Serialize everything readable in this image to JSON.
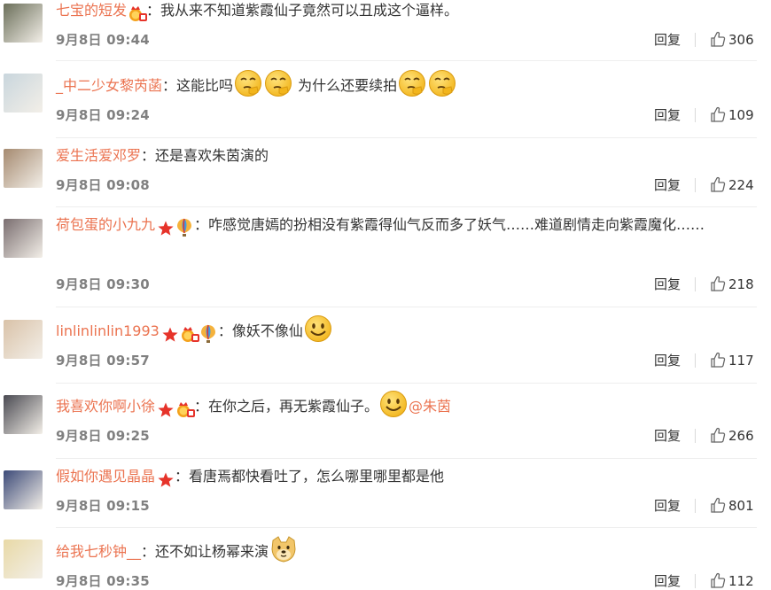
{
  "colors": {
    "username": "#eb7350",
    "text": "#333333",
    "meta": "#808080",
    "divider": "#eeeeee"
  },
  "comments": [
    {
      "user": "七宝的短发",
      "badges": [
        "vip-crown-icon"
      ],
      "text_parts": [
        {
          "t": "text",
          "v": "：我从来不知道紫霞仙子竟然可以丑成这个逼样。"
        }
      ],
      "time": "9月8日 09:44",
      "reply": "回复",
      "likes": "306",
      "avatar_color": "#6b6f5a"
    },
    {
      "user": "_中二少女黎芮菡",
      "badges": [],
      "text_parts": [
        {
          "t": "text",
          "v": "：这能比吗"
        },
        {
          "t": "emoji",
          "v": "thinking-emoji"
        },
        {
          "t": "emoji",
          "v": "thinking-emoji"
        },
        {
          "t": "text",
          "v": " 为什么还要续拍"
        },
        {
          "t": "emoji",
          "v": "thinking-emoji"
        },
        {
          "t": "emoji",
          "v": "thinking-emoji"
        }
      ],
      "time": "9月8日 09:24",
      "reply": "回复",
      "likes": "109",
      "avatar_color": "#c9d6dd"
    },
    {
      "user": "爱生活爱邓罗",
      "badges": [],
      "text_parts": [
        {
          "t": "text",
          "v": "：还是喜欢朱茵演的"
        }
      ],
      "time": "9月8日 09:08",
      "reply": "回复",
      "likes": "224",
      "avatar_color": "#a58a70"
    },
    {
      "user": "荷包蛋的小九九",
      "badges": [
        "red-star-icon",
        "balloon-icon"
      ],
      "text_parts": [
        {
          "t": "text",
          "v": "：咋感觉唐嫣的扮相没有紫霞得仙气反而多了妖气……难道剧情走向紫霞魔化……"
        }
      ],
      "time": "9月8日 09:30",
      "reply": "回复",
      "likes": "218",
      "avatar_color": "#7a6e70"
    },
    {
      "user": "linlinlinlin1993",
      "badges": [
        "red-star-icon",
        "vip-crown-icon",
        "balloon-icon"
      ],
      "text_parts": [
        {
          "t": "text",
          "v": "：像妖不像仙"
        },
        {
          "t": "emoji",
          "v": "smile-emoji"
        }
      ],
      "time": "9月8日 09:57",
      "reply": "回复",
      "likes": "117",
      "avatar_color": "#d9c2a8"
    },
    {
      "user": "我喜欢你啊小徐",
      "badges": [
        "red-star-icon",
        "vip-crown-icon"
      ],
      "text_parts": [
        {
          "t": "text",
          "v": "：在你之后，再无紫霞仙子。"
        },
        {
          "t": "emoji",
          "v": "smile-emoji"
        },
        {
          "t": "mention",
          "v": "@朱茵"
        }
      ],
      "time": "9月8日 09:25",
      "reply": "回复",
      "likes": "266",
      "avatar_color": "#4a4a52"
    },
    {
      "user": "假如你遇见晶晶",
      "badges": [
        "red-star-icon"
      ],
      "text_parts": [
        {
          "t": "text",
          "v": "：看唐焉都快看吐了，怎么哪里哪里都是他"
        }
      ],
      "time": "9月8日 09:15",
      "reply": "回复",
      "likes": "801",
      "avatar_color": "#3c4a78"
    },
    {
      "user": "给我七秒钟__",
      "badges": [],
      "text_parts": [
        {
          "t": "text",
          "v": "：还不如让杨幂来演"
        },
        {
          "t": "emoji",
          "v": "doge-emoji"
        }
      ],
      "time": "9月8日 09:35",
      "reply": "回复",
      "likes": "112",
      "avatar_color": "#e8d9a6"
    }
  ]
}
